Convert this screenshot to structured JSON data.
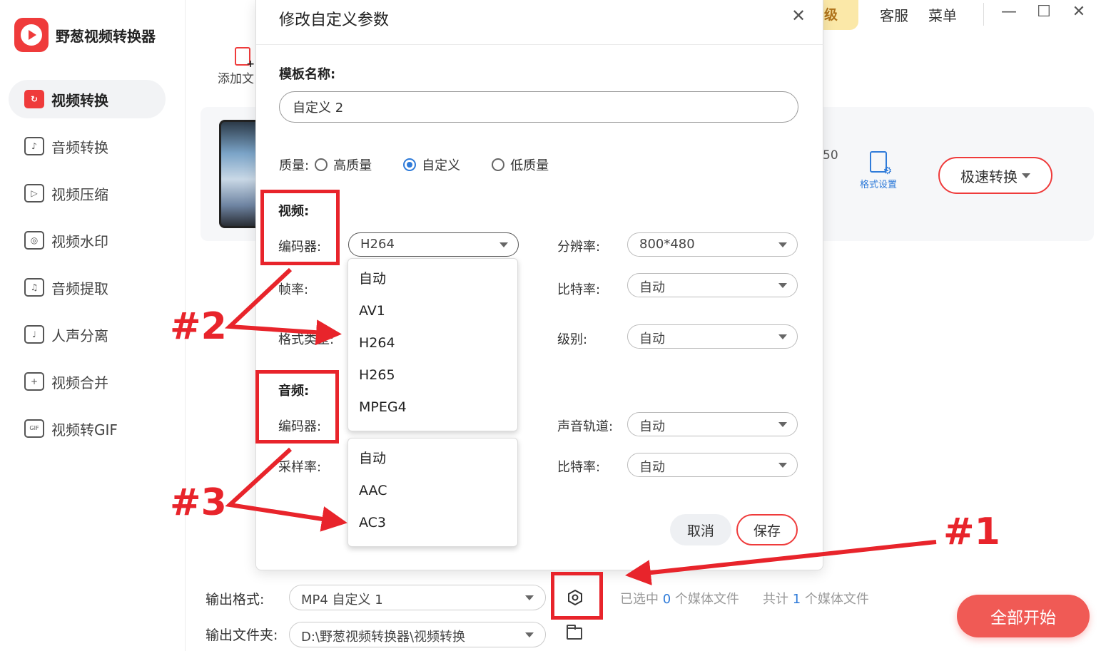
{
  "app": {
    "name": "野葱视频转换器",
    "upgrade_label": "级",
    "service_label": "客服",
    "menu_label": "菜单",
    "minimize_glyph": "—",
    "maximize_glyph": "☐",
    "close_glyph": "✕"
  },
  "sidebar": {
    "items": [
      {
        "label": "视频转换",
        "icon": "video-convert-icon",
        "glyph": "↻",
        "active": true
      },
      {
        "label": "音频转换",
        "icon": "audio-convert-icon",
        "glyph": "♪",
        "active": false
      },
      {
        "label": "视频压缩",
        "icon": "video-compress-icon",
        "glyph": "▷",
        "active": false
      },
      {
        "label": "视频水印",
        "icon": "video-watermark-icon",
        "glyph": "◎",
        "active": false
      },
      {
        "label": "音频提取",
        "icon": "audio-extract-icon",
        "glyph": "♫",
        "active": false
      },
      {
        "label": "人声分离",
        "icon": "voice-separate-icon",
        "glyph": "♩",
        "active": false
      },
      {
        "label": "视频合并",
        "icon": "video-merge-icon",
        "glyph": "+",
        "active": false
      },
      {
        "label": "视频转GIF",
        "icon": "video-gif-icon",
        "glyph": "GIF",
        "active": false
      }
    ]
  },
  "main": {
    "add_file_label": "添加文",
    "card_fragment": "50",
    "format_settings_label": "格式设置",
    "speed_convert_label": "极速转换"
  },
  "bottom": {
    "output_format_label": "输出格式:",
    "output_format_value": "MP4 自定义 1",
    "output_folder_label": "输出文件夹:",
    "output_folder_value": "D:\\野葱视频转换器\\视频转换",
    "selected_prefix": "已选中",
    "selected_count": "0",
    "selected_suffix": "个媒体文件",
    "total_prefix": "共计",
    "total_count": "1",
    "total_suffix": "个媒体文件",
    "start_all_label": "全部开始"
  },
  "dialog": {
    "title": "修改自定义参数",
    "close_glyph": "✕",
    "template_name_label": "模板名称:",
    "template_name_value": "自定义 2",
    "quality_label": "质量:",
    "quality_options": [
      {
        "label": "高质量",
        "selected": false
      },
      {
        "label": "自定义",
        "selected": true
      },
      {
        "label": "低质量",
        "selected": false
      }
    ],
    "video": {
      "heading": "视频:",
      "codec_label": "编码器:",
      "codec_value": "H264",
      "framerate_label": "帧率:",
      "format_type_label": "格式类型:",
      "resolution_label": "分辨率:",
      "resolution_value": "800*480",
      "bitrate_label": "比特率:",
      "bitrate_value": "自动",
      "level_label": "级别:",
      "level_value": "自动",
      "codec_options": [
        "自动",
        "AV1",
        "H264",
        "H265",
        "MPEG4"
      ]
    },
    "audio": {
      "heading": "音频:",
      "codec_label": "编码器:",
      "samplerate_label": "采样率:",
      "channel_label": "声音轨道:",
      "channel_value": "自动",
      "bitrate_label": "比特率:",
      "bitrate_value": "自动",
      "codec_options": [
        "自动",
        "AAC",
        "AC3"
      ]
    },
    "cancel_label": "取消",
    "save_label": "保存"
  },
  "annotations": {
    "label_1": "#1",
    "label_2": "#2",
    "label_3": "#3",
    "color": "#e8242b"
  }
}
